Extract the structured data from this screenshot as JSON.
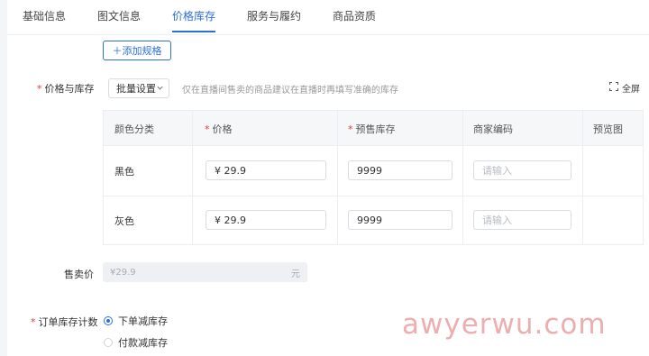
{
  "tabs": [
    {
      "label": "基础信息",
      "active": false
    },
    {
      "label": "图文信息",
      "active": false
    },
    {
      "label": "价格库存",
      "active": true
    },
    {
      "label": "服务与履约",
      "active": false
    },
    {
      "label": "商品资质",
      "active": false
    }
  ],
  "add_spec_label": "＋添加规格",
  "price_stock": {
    "label": "价格与库存",
    "required": "*",
    "batch_label": "批量设置",
    "hint": "仅在直播间售卖的商品建议在直播时再填写准确的库存",
    "fullscreen_label": "全屏"
  },
  "table": {
    "headers": [
      "颜色分类",
      "价格",
      "预售库存",
      "商家编码",
      "预览图"
    ],
    "required_mark": "*",
    "rows": [
      {
        "color": "黑色",
        "price": "¥  29.9",
        "stock": "9999",
        "code_placeholder": "请输入"
      },
      {
        "color": "灰色",
        "price": "¥  29.9",
        "stock": "9999",
        "code_placeholder": "请输入"
      }
    ]
  },
  "sale_price": {
    "label": "售卖价",
    "value": "¥29.9",
    "unit": "元"
  },
  "order_stock": {
    "label": "订单库存计数",
    "required": "*",
    "options": [
      {
        "label": "下单减库存",
        "selected": true
      },
      {
        "label": "付款减库存",
        "selected": false
      }
    ]
  },
  "watermark": "awyerwu.com",
  "colors": {
    "accent": "#2b6fd8",
    "required": "#e03b3b",
    "watermark": "#e9a0a0"
  }
}
